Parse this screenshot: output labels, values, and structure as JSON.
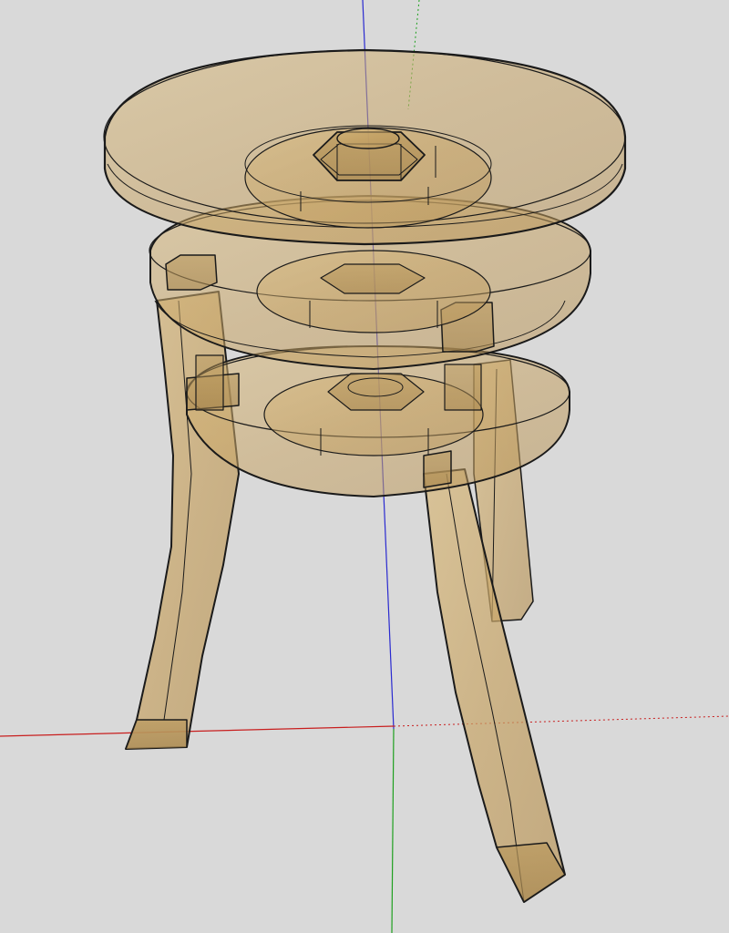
{
  "viewport": {
    "background": "#d9d9d9",
    "render_mode": "x-ray",
    "axes": {
      "red": "#c81e1e",
      "green": "#1fa01f",
      "blue": "#2a2ad0"
    }
  },
  "model": {
    "object": "three-legged-stool",
    "material_fill": "#c9a86a",
    "material_opacity": 0.55,
    "edge_color": "#1a1a1a",
    "components": [
      "seat-top",
      "middle-ring",
      "lower-ring",
      "front-left-leg",
      "rear-right-leg",
      "front-right-leg",
      "hex-nut",
      "hub-discs",
      "dowel-pins",
      "tenon-blocks"
    ]
  }
}
